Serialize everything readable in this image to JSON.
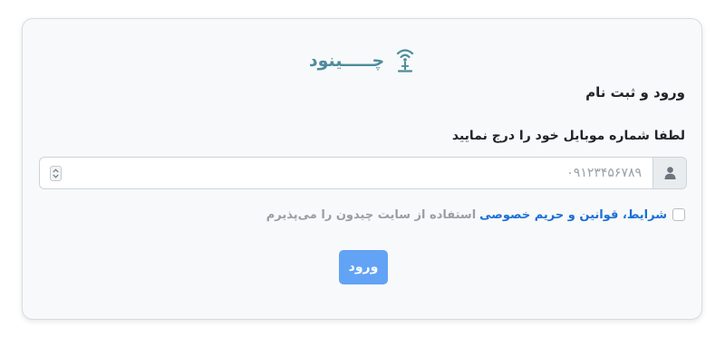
{
  "logo": {
    "text": "چـــــینود",
    "icon": "wifi-tower-icon",
    "color": "#4c8c9c"
  },
  "form": {
    "title": "ورود و ثبت نام",
    "phone_label": "لطفا شماره موبایل خود را درج نمایید",
    "phone_placeholder": "۰۹۱۲۳۴۵۶۷۸۹",
    "phone_value": "",
    "user_icon": "user-icon",
    "terms": {
      "checked": false,
      "link_text": "شرایط، قوانین و حریم خصوصی",
      "text": "استفاده از سایت چیدون را می‌پذیرم",
      "link_color": "#1a6fd6"
    },
    "submit_label": "ورود",
    "submit_color": "#62a3f6"
  }
}
